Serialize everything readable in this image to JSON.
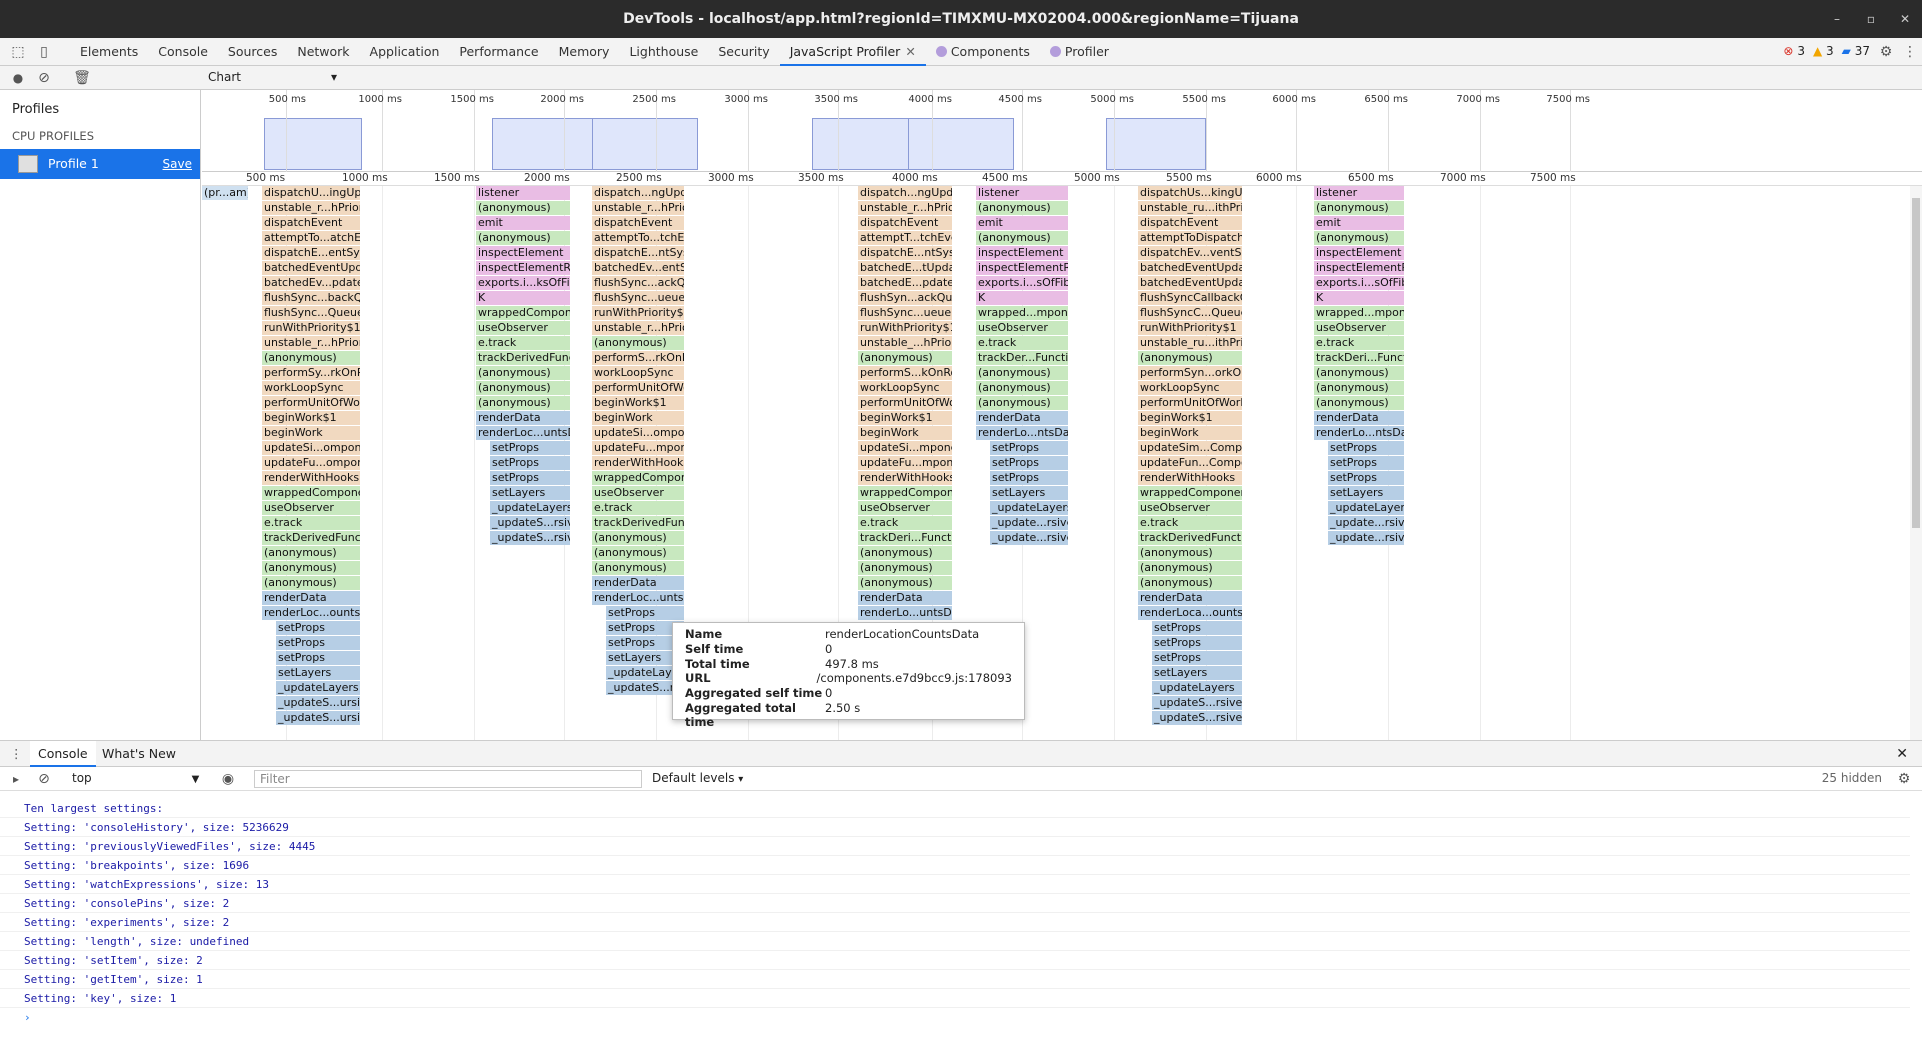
{
  "window": {
    "title": "DevTools - localhost/app.html?regionId=TIMXMU-MX02004.000&regionName=Tijuana"
  },
  "tabs": [
    "Elements",
    "Console",
    "Sources",
    "Network",
    "Application",
    "Performance",
    "Memory",
    "Lighthouse",
    "Security",
    "JavaScript Profiler",
    "Components",
    "Profiler"
  ],
  "badges": {
    "errors": "3",
    "warnings": "3",
    "messages": "37"
  },
  "sidebar": {
    "heading": "Profiles",
    "category": "CPU PROFILES",
    "profile": "Profile 1",
    "save": "Save"
  },
  "view_select": "Chart",
  "overview_ticks": [
    "500 ms",
    "1000 ms",
    "1500 ms",
    "2000 ms",
    "2500 ms",
    "3000 ms",
    "3500 ms",
    "4000 ms",
    "4500 ms",
    "5000 ms",
    "5500 ms",
    "6000 ms",
    "6500 ms",
    "7000 ms",
    "7500 ms"
  ],
  "ruler_ticks": [
    "500 ms",
    "1000 ms",
    "1500 ms",
    "2000 ms",
    "2500 ms",
    "3000 ms",
    "3500 ms",
    "4000 ms",
    "4500 ms",
    "5000 ms",
    "5500 ms",
    "6000 ms",
    "6500 ms",
    "7000 ms",
    "7500 ms"
  ],
  "flame_columns": [
    {
      "frames": [
        "(pr...am)"
      ]
    },
    {
      "frames": [
        "dispatchU...ingUpdate",
        "unstable_r...hPriority",
        "dispatchEvent",
        "attemptTo...atchEvent",
        "dispatchE...entSystem",
        "batchedEventUpdates",
        "batchedEv...pdates$1",
        "flushSync...backQueue",
        "flushSync...QueueImpl",
        "runWithPriority$1",
        "unstable_r...hPriority",
        "(anonymous)",
        "performSy...rkOnRoot",
        "workLoopSync",
        "performUnitOfWork",
        "beginWork$1",
        "beginWork",
        "updateSi...omponent",
        "updateFu...omponent",
        "renderWithHooks",
        "wrappedComponent",
        "useObserver",
        "e.track",
        "trackDerivedFunction",
        "(anonymous)",
        "(anonymous)",
        "(anonymous)",
        "renderData",
        "renderLoc...ountsData",
        "setProps",
        "setProps",
        "setProps",
        "setLayers",
        "_updateLayers",
        "_updateS...ursively",
        "_updateS...ursively"
      ]
    },
    {
      "frames": [
        "listener",
        "(anonymous)",
        "emit",
        "(anonymous)",
        "inspectElement",
        "inspectElementRaw",
        "exports.i...ksOfFiber",
        "K",
        "wrappedComponent",
        "useObserver",
        "e.track",
        "trackDerivedFunction",
        "(anonymous)",
        "(anonymous)",
        "(anonymous)",
        "renderData",
        "renderLoc...untsData",
        "setProps",
        "setProps",
        "setProps",
        "setLayers",
        "_updateLayers",
        "_updateS...rsively",
        "_updateS...rsively"
      ]
    },
    {
      "frames": [
        "dispatch...ngUpdate",
        "unstable_r...hPriority",
        "dispatchEvent",
        "attemptTo...tchEvent",
        "dispatchE...ntSystem",
        "batchedEv...entSystem",
        "flushSync...ackQueue",
        "flushSync...ueueImpl",
        "runWithPriority$1",
        "unstable_r...hPriority",
        "(anonymous)",
        "performS...rkOnRoot",
        "workLoopSync",
        "performUnitOfWork",
        "beginWork$1",
        "beginWork",
        "updateSi...omponent",
        "updateFu...mponent",
        "renderWithHooks",
        "wrappedComponent",
        "useObserver",
        "e.track",
        "trackDerivedFunction",
        "(anonymous)",
        "(anonymous)",
        "(anonymous)",
        "renderData",
        "renderLoc...untsData",
        "setProps",
        "setProps",
        "setProps",
        "setLayers",
        "_updateLayers",
        "_updateS...rsively"
      ]
    },
    {
      "frames": [
        "dispatch...ngUpdate",
        "unstable_r...hPriority",
        "dispatchEvent",
        "attemptT...tchEvent",
        "dispatchE...ntSystem",
        "batchedE...tUpdates",
        "batchedE...pdates$1",
        "flushSyn...ackQueue",
        "flushSync...ueueImpl",
        "runWithPriority$1",
        "unstable_...hPriority",
        "(anonymous)",
        "performS...kOnRoot",
        "workLoopSync",
        "performUnitOfWork",
        "beginWork$1",
        "beginWork",
        "updateSi...mponent",
        "updateFu...mponent",
        "renderWithHooks",
        "wrappedComponent",
        "useObserver",
        "e.track",
        "trackDeri...Function",
        "(anonymous)",
        "(anonymous)",
        "(anonymous)",
        "renderData",
        "renderLo...untsData"
      ]
    },
    {
      "frames": [
        "listener",
        "(anonymous)",
        "emit",
        "(anonymous)",
        "inspectElement",
        "inspectElementRaw",
        "exports.i...sOfFiber",
        "K",
        "wrapped...mponent",
        "useObserver",
        "e.track",
        "trackDer...Function",
        "(anonymous)",
        "(anonymous)",
        "(anonymous)",
        "renderData",
        "renderLo...ntsData",
        "setProps",
        "setProps",
        "setProps",
        "setLayers",
        "_updateLayers",
        "_update...rsively",
        "_update...rsively"
      ]
    },
    {
      "frames": [
        "dispatchUs...kingUpdate",
        "unstable_ru...ithPriority",
        "dispatchEvent",
        "attemptToDispatchEvent",
        "dispatchEv...ventSystem",
        "batchedEventUpdates",
        "batchedEventUpdates$1",
        "flushSyncCallbackQueue",
        "flushSyncC...QueueImpl",
        "runWithPriority$1",
        "unstable_ru...ithPriority",
        "(anonymous)",
        "performSyn...orkOnRoot",
        "workLoopSync",
        "performUnitOfWork",
        "beginWork$1",
        "beginWork",
        "updateSim...Component",
        "updateFun...Component",
        "renderWithHooks",
        "wrappedComponent",
        "useObserver",
        "e.track",
        "trackDerivedFunction",
        "(anonymous)",
        "(anonymous)",
        "(anonymous)",
        "renderData",
        "renderLoca...ountsData",
        "setProps",
        "setProps",
        "setProps",
        "setLayers",
        "_updateLayers",
        "_updateS...rsively",
        "_updateS...rsively"
      ]
    },
    {
      "frames": [
        "listener",
        "(anonymous)",
        "emit",
        "(anonymous)",
        "inspectElement",
        "inspectElementRaw",
        "exports.i...sOfFiber",
        "K",
        "wrapped...mponent",
        "useObserver",
        "e.track",
        "trackDeri...Function",
        "(anonymous)",
        "(anonymous)",
        "(anonymous)",
        "renderData",
        "renderLo...ntsData",
        "setProps",
        "setProps",
        "setProps",
        "setLayers",
        "_updateLayers",
        "_update...rsively",
        "_update...rsively"
      ]
    }
  ],
  "tooltip": {
    "labels": [
      "Name",
      "Self time",
      "Total time",
      "URL",
      "Aggregated self time",
      "Aggregated total time"
    ],
    "values": [
      "renderLocationCountsData",
      "0",
      "497.8 ms",
      "/components.e7d9bcc9.js:178093",
      "0",
      "2.50 s"
    ]
  },
  "drawer": {
    "tab_console": "Console",
    "tab_whatsnew": "What's New",
    "context": "top",
    "filter_placeholder": "Filter",
    "levels": "Default levels",
    "hidden": "25 hidden"
  },
  "console_lines": [
    "Ten largest settings:",
    "Setting: 'consoleHistory', size: 5236629",
    "Setting: 'previouslyViewedFiles', size: 4445",
    "Setting: 'breakpoints', size: 1696",
    "Setting: 'watchExpressions', size: 13",
    "Setting: 'consolePins', size: 2",
    "Setting: 'experiments', size: 2",
    "Setting: 'length', size: undefined",
    "Setting: 'setItem', size: 2",
    "Setting: 'getItem', size: 1",
    "Setting: 'key', size: 1"
  ],
  "colors": {
    "accent": "#1a73e8",
    "frame_orange": "#f1d9c0",
    "frame_pink": "#e9bde4",
    "frame_green": "#c8e8bf",
    "frame_blue": "#b6cee5"
  }
}
